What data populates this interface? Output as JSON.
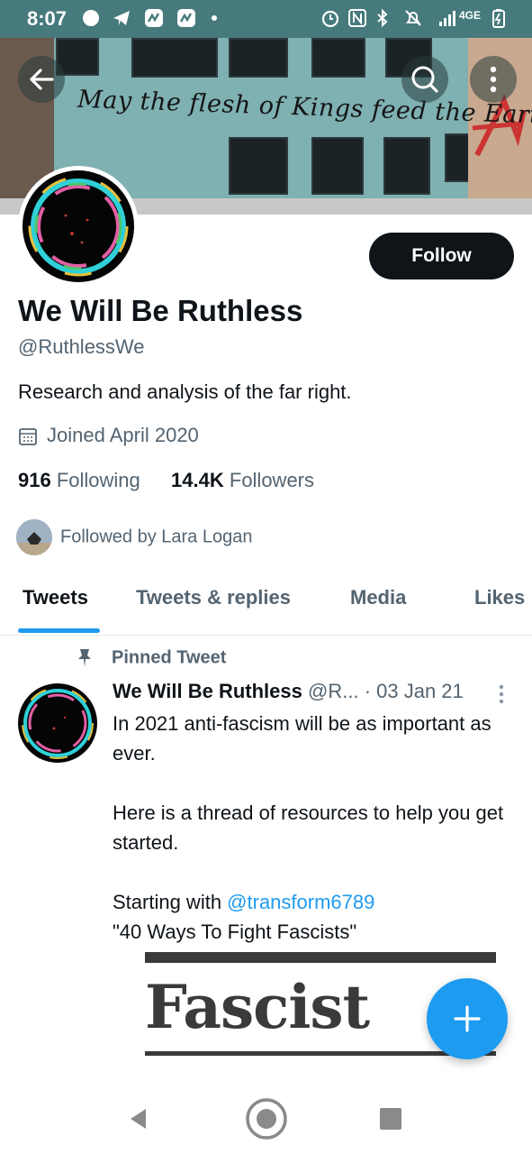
{
  "status_bar": {
    "time": "8:07",
    "network": "4GE",
    "icons": [
      "signal-app-icon",
      "telegram-icon",
      "app-icon-1",
      "app-icon-2",
      "dot-icon",
      "alarm-icon",
      "nfc-icon",
      "bluetooth-icon",
      "mute-icon",
      "cell-signal-icon",
      "battery-icon"
    ]
  },
  "banner": {
    "graffiti_text": "May the flesh of Kings feed the Earth"
  },
  "profile": {
    "follow_label": "Follow",
    "display_name": "We Will Be Ruthless",
    "handle": "@RuthlessWe",
    "bio": "Research and analysis of the far right.",
    "joined": "Joined April 2020",
    "following_count": "916",
    "following_label": "Following",
    "followers_count": "14.4K",
    "followers_label": "Followers",
    "followed_by": "Followed by Lara Logan"
  },
  "tabs": [
    "Tweets",
    "Tweets & replies",
    "Media",
    "Likes"
  ],
  "active_tab": "Tweets",
  "pinned_tweet": {
    "label": "Pinned Tweet",
    "author": "We Will Be Ruthless",
    "handle_trunc": "@R...",
    "date": "· 03 Jan 21",
    "line1": "In 2021 anti-fascism will be as important as ever.",
    "line2": "Here is a thread of resources to help you get started.",
    "line3_prefix": "Starting with ",
    "mention": "@transform6789",
    "line4": "\"40 Ways To Fight Fascists\"",
    "media_text": "Fascist"
  },
  "colors": {
    "accent": "#1d9bf0",
    "status_bar": "#467a7c",
    "text_primary": "#0f1419",
    "text_secondary": "#536471"
  }
}
